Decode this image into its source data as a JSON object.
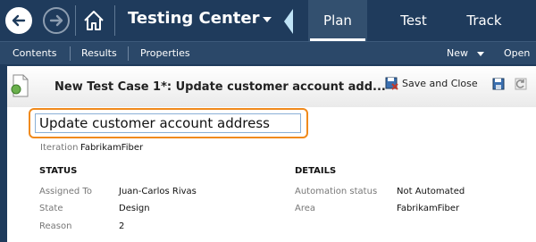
{
  "app": {
    "title": "Testing Center"
  },
  "tabs": [
    {
      "label": "Plan"
    },
    {
      "label": "Test"
    },
    {
      "label": "Track"
    }
  ],
  "menu": {
    "contents": "Contents",
    "results": "Results",
    "properties": "Properties",
    "new": "New",
    "open": "Open"
  },
  "work_item": {
    "header_title": "New Test Case 1*: Update customer account add...",
    "save_close_label": "Save and Close",
    "title_value": "Update customer account address",
    "iteration_label": "Iteration",
    "iteration_value": "FabrikamFiber"
  },
  "status": {
    "heading": "STATUS",
    "assigned_to_label": "Assigned To",
    "assigned_to_value": "Juan-Carlos Rivas",
    "state_label": "State",
    "state_value": "Design",
    "reason_label": "Reason",
    "reason_value": "2"
  },
  "details": {
    "heading": "DETAILS",
    "automation_status_label": "Automation status",
    "automation_status_value": "Not Automated",
    "area_label": "Area",
    "area_value": "FabrikamFiber"
  },
  "icons": {
    "back": "arrow-left-icon",
    "forward": "arrow-right-icon",
    "home": "home-icon",
    "save_close": "save-close-icon",
    "save": "floppy-save-icon",
    "refresh": "refresh-icon"
  },
  "colors": {
    "header_bg": "#1f3b5c",
    "menubar_bg": "#2b4869",
    "active_tab_bg": "#33506f",
    "title_highlight": "#f08a1c"
  }
}
